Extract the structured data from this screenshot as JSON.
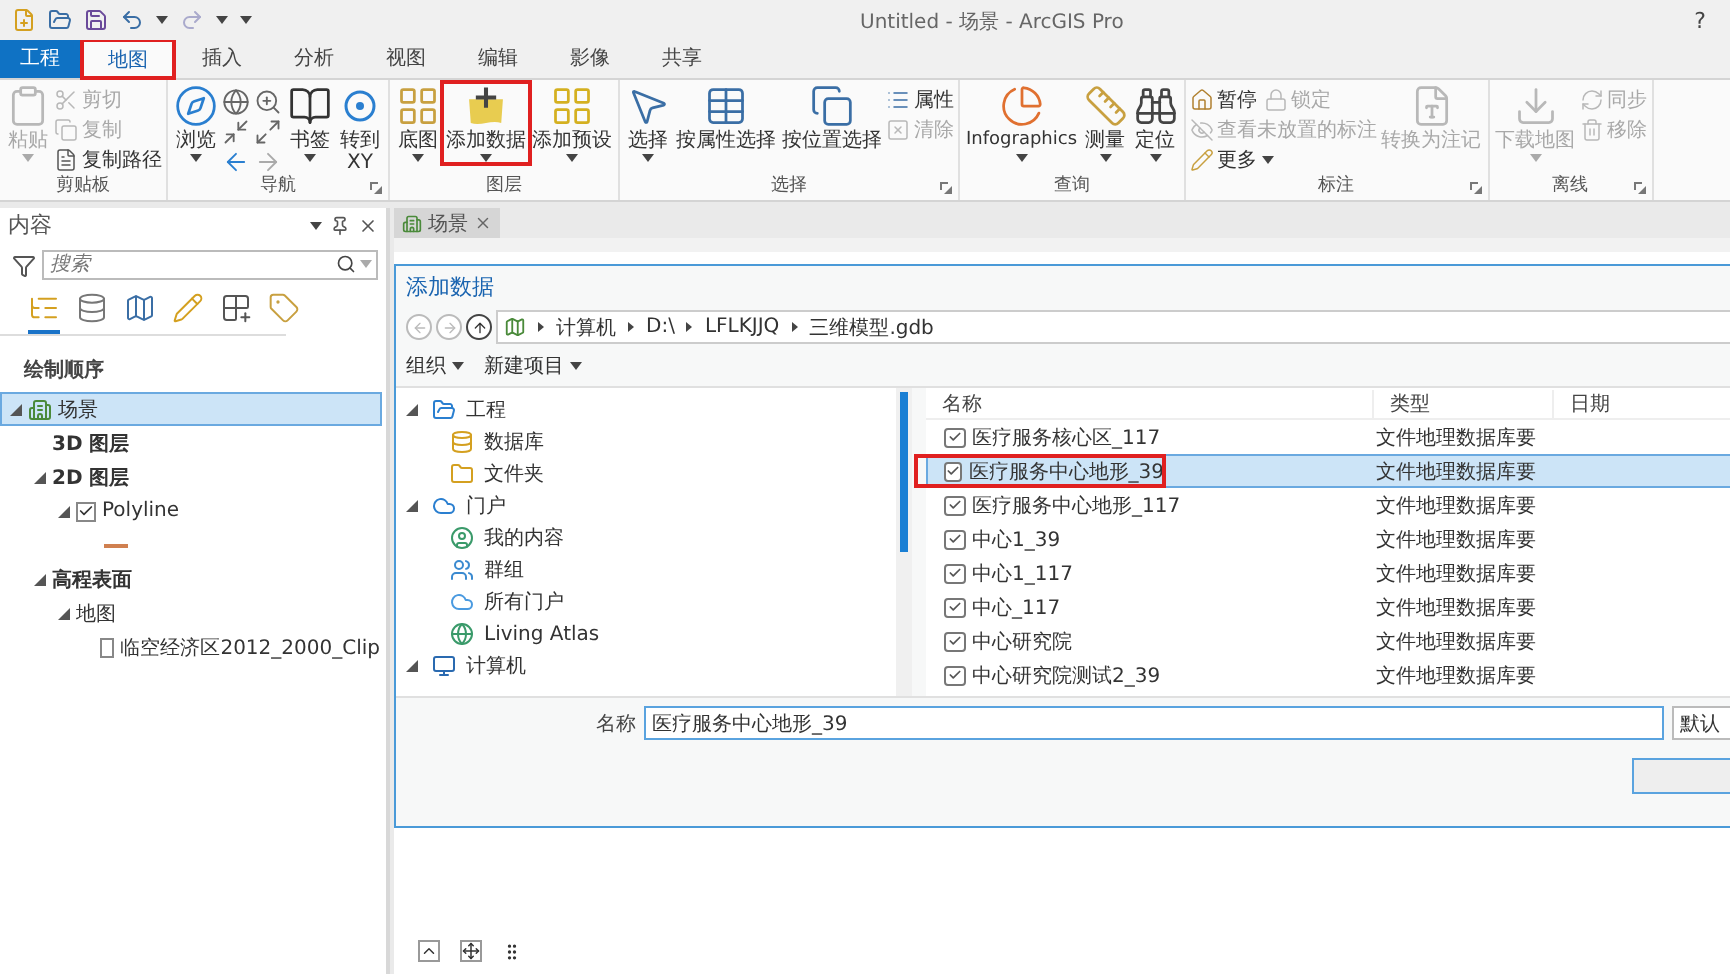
{
  "window": {
    "title": "Untitled - 场景 - ArcGIS Pro",
    "help": "?"
  },
  "ribbon_tabs": [
    {
      "label": "工程",
      "kind": "file",
      "selected": false,
      "annotated": false
    },
    {
      "label": "地图",
      "kind": "tab",
      "selected": true,
      "annotated": true
    },
    {
      "label": "插入",
      "kind": "tab",
      "selected": false,
      "annotated": false
    },
    {
      "label": "分析",
      "kind": "tab",
      "selected": false,
      "annotated": false
    },
    {
      "label": "视图",
      "kind": "tab",
      "selected": false,
      "annotated": false
    },
    {
      "label": "编辑",
      "kind": "tab",
      "selected": false,
      "annotated": false
    },
    {
      "label": "影像",
      "kind": "tab",
      "selected": false,
      "annotated": false
    },
    {
      "label": "共享",
      "kind": "tab",
      "selected": false,
      "annotated": false
    }
  ],
  "ribbon": {
    "groups": [
      {
        "label": "剪贴板",
        "launcher": false,
        "columns": [
          {
            "kind": "large",
            "label": "粘贴",
            "disabled": true,
            "dropdown": true,
            "annotated": false
          },
          {
            "kind": "stack",
            "rows": [
              [
                {
                  "label": "剪切",
                  "disabled": true,
                  "dropdown": false
                }
              ],
              [
                {
                  "label": "复制",
                  "disabled": true,
                  "dropdown": false
                }
              ],
              [
                {
                  "label": "复制路径",
                  "disabled": false,
                  "dropdown": false
                }
              ]
            ]
          }
        ]
      },
      {
        "label": "导航",
        "launcher": true,
        "columns": [
          {
            "kind": "large",
            "label": "浏览",
            "disabled": false,
            "dropdown": true,
            "annotated": false
          },
          {
            "kind": "nav-grid"
          },
          {
            "kind": "large",
            "label": "书签",
            "disabled": false,
            "dropdown": true,
            "annotated": false
          },
          {
            "kind": "large",
            "label": "转到\nXY",
            "disabled": false,
            "dropdown": false,
            "annotated": false
          }
        ]
      },
      {
        "label": "图层",
        "launcher": false,
        "columns": [
          {
            "kind": "large",
            "label": "底图",
            "disabled": false,
            "dropdown": true,
            "annotated": false
          },
          {
            "kind": "large",
            "label": "添加数据",
            "disabled": false,
            "dropdown": true,
            "annotated": true
          },
          {
            "kind": "large",
            "label": "添加预设",
            "disabled": false,
            "dropdown": true,
            "annotated": false
          }
        ]
      },
      {
        "label": "选择",
        "launcher": true,
        "columns": [
          {
            "kind": "large",
            "label": "选择",
            "disabled": false,
            "dropdown": true,
            "annotated": false
          },
          {
            "kind": "large",
            "label": "按属性选择",
            "disabled": false,
            "dropdown": false,
            "annotated": false
          },
          {
            "kind": "large",
            "label": "按位置选择",
            "disabled": false,
            "dropdown": false,
            "annotated": false
          },
          {
            "kind": "stack",
            "rows": [
              [
                {
                  "label": "属性",
                  "disabled": false,
                  "dropdown": false
                }
              ],
              [
                {
                  "label": "清除",
                  "disabled": true,
                  "dropdown": false
                }
              ]
            ]
          }
        ]
      },
      {
        "label": "查询",
        "launcher": false,
        "columns": [
          {
            "kind": "large",
            "label": "Infographics",
            "disabled": false,
            "dropdown": true,
            "annotated": false
          },
          {
            "kind": "large",
            "label": "测量",
            "disabled": false,
            "dropdown": true,
            "annotated": false
          },
          {
            "kind": "large",
            "label": "定位",
            "disabled": false,
            "dropdown": true,
            "annotated": false
          }
        ]
      },
      {
        "label": "标注",
        "launcher": true,
        "columns": [
          {
            "kind": "stack",
            "rows": [
              [
                {
                  "label": "暂停",
                  "disabled": false,
                  "dropdown": false
                },
                {
                  "label": "锁定",
                  "disabled": true,
                  "dropdown": false
                }
              ],
              [
                {
                  "label": "查看未放置的标注",
                  "disabled": true,
                  "dropdown": false
                }
              ],
              [
                {
                  "label": "更多",
                  "disabled": false,
                  "dropdown": true
                }
              ]
            ]
          },
          {
            "kind": "large",
            "label": "转换为注记",
            "disabled": true,
            "dropdown": false,
            "annotated": false
          }
        ]
      },
      {
        "label": "离线",
        "launcher": true,
        "columns": [
          {
            "kind": "large",
            "label": "下载地图",
            "disabled": true,
            "dropdown": true,
            "annotated": false
          },
          {
            "kind": "stack",
            "rows": [
              [
                {
                  "label": "同步",
                  "disabled": true,
                  "dropdown": false
                }
              ],
              [
                {
                  "label": "移除",
                  "disabled": true,
                  "dropdown": false
                }
              ]
            ]
          }
        ]
      }
    ]
  },
  "contents_pane": {
    "title": "内容",
    "search": {
      "placeholder": "搜索"
    },
    "tools": [
      {
        "selected": true
      },
      {
        "selected": false
      },
      {
        "selected": false
      },
      {
        "selected": false
      },
      {
        "selected": false
      },
      {
        "selected": false
      }
    ],
    "heading": "绘制顺序",
    "tree": [
      {
        "kind": "scene",
        "label": "场景",
        "selected": true,
        "expanded": true,
        "children": [
          {
            "kind": "category",
            "label": "3D 图层",
            "selected": false
          },
          {
            "kind": "category",
            "label": "2D 图层",
            "selected": false,
            "expanded": true,
            "children": [
              {
                "kind": "layer",
                "label": "Polyline",
                "selected": false,
                "checked": true,
                "expanded": true,
                "children": [
                  {
                    "kind": "symbol",
                    "selected": false
                  }
                ]
              }
            ]
          },
          {
            "kind": "category",
            "label": "高程表面",
            "selected": false,
            "expanded": true,
            "children": [
              {
                "kind": "source",
                "label": "地图",
                "selected": false,
                "expanded": true,
                "children": [
                  {
                    "kind": "layer",
                    "label": "临空经济区2012_2000_Clip",
                    "selected": false,
                    "checked": false
                  }
                ]
              }
            ]
          }
        ]
      }
    ]
  },
  "view_tabs": [
    {
      "label": "场景",
      "selected": true
    }
  ],
  "dialog": {
    "title": "添加数据",
    "path": [
      "计算机",
      "D:\\",
      "LFLKJJQ",
      "三维模型.gdb"
    ],
    "toolbar": [
      {
        "label": "组织"
      },
      {
        "label": "新建项目"
      }
    ],
    "folders": [
      {
        "kind": "project",
        "label": "工程",
        "expanded": true,
        "children": [
          {
            "kind": "database",
            "label": "数据库"
          },
          {
            "kind": "folder",
            "label": "文件夹"
          }
        ]
      },
      {
        "kind": "portal",
        "label": "门户",
        "expanded": true,
        "children": [
          {
            "kind": "my-content",
            "label": "我的内容"
          },
          {
            "kind": "groups",
            "label": "群组"
          },
          {
            "kind": "all-portals",
            "label": "所有门户"
          },
          {
            "kind": "living-atlas",
            "label": "Living Atlas"
          }
        ]
      },
      {
        "kind": "computer",
        "label": "计算机",
        "expanded": true
      }
    ],
    "columns": [
      "名称",
      "类型",
      "日期"
    ],
    "rows": [
      {
        "name": "医疗服务核心区_117",
        "type": "文件地理数据库要",
        "selected": false,
        "annotated": false
      },
      {
        "name": "医疗服务中心地形_39",
        "type": "文件地理数据库要",
        "selected": true,
        "annotated": true
      },
      {
        "name": "医疗服务中心地形_117",
        "type": "文件地理数据库要",
        "selected": false,
        "annotated": false
      },
      {
        "name": "中心1_39",
        "type": "文件地理数据库要",
        "selected": false,
        "annotated": false
      },
      {
        "name": "中心1_117",
        "type": "文件地理数据库要",
        "selected": false,
        "annotated": false
      },
      {
        "name": "中心_117",
        "type": "文件地理数据库要",
        "selected": false,
        "annotated": false
      },
      {
        "name": "中心研究院",
        "type": "文件地理数据库要",
        "selected": false,
        "annotated": false
      },
      {
        "name": "中心研究院测试2_39",
        "type": "文件地理数据库要",
        "selected": false,
        "annotated": false
      }
    ],
    "name_field": {
      "label": "名称",
      "value": "医疗服务中心地形_39"
    },
    "filter": {
      "value": "默认"
    }
  }
}
